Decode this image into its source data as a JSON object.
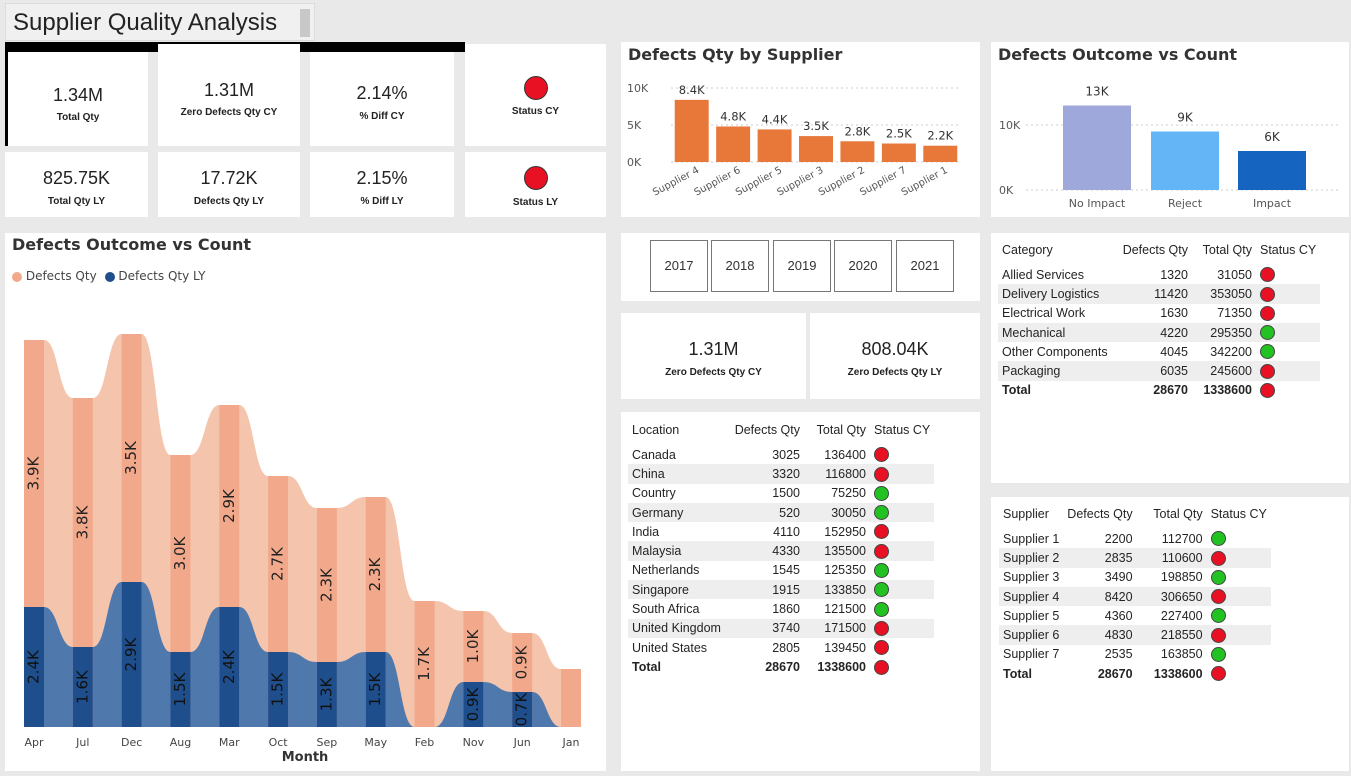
{
  "page_title": "Supplier Quality Analysis",
  "kpis": {
    "total_qty": {
      "value": "1.34M",
      "label": "Total Qty"
    },
    "zero_defects_cy": {
      "value": "1.31M",
      "label": "Zero Defects Qty CY"
    },
    "pct_diff_cy": {
      "value": "2.14%",
      "label": "% Diff CY"
    },
    "status_cy": {
      "label": "Status CY",
      "color": "#e81123"
    },
    "total_qty_ly": {
      "value": "825.75K",
      "label": "Total Qty LY"
    },
    "defects_qty_ly": {
      "value": "17.72K",
      "label": "Defects Qty LY"
    },
    "pct_diff_ly": {
      "value": "2.15%",
      "label": "% Diff LY"
    },
    "status_ly": {
      "label": "Status LY",
      "color": "#e81123"
    }
  },
  "supplier_chart_title": "Defects Qty by Supplier",
  "outcome_chart_title": "Defects Outcome vs Count",
  "ribbon_chart_title": "Defects Outcome vs Count",
  "year_slicer": [
    "2017",
    "2018",
    "2019",
    "2020",
    "2021"
  ],
  "zero_cards": {
    "cy": {
      "value": "1.31M",
      "label": "Zero Defects Qty CY"
    },
    "ly": {
      "value": "808.04K",
      "label": "Zero Defects Qty LY"
    }
  },
  "chart_data": [
    {
      "type": "bar",
      "title": "Defects Qty by Supplier",
      "categories": [
        "Supplier 4",
        "Supplier 6",
        "Supplier 5",
        "Supplier 3",
        "Supplier 2",
        "Supplier 7",
        "Supplier 1"
      ],
      "values": [
        8.4,
        4.8,
        4.4,
        3.5,
        2.8,
        2.5,
        2.2
      ],
      "labels": [
        "8.4K",
        "4.8K",
        "4.4K",
        "3.5K",
        "2.8K",
        "2.5K",
        "2.2K"
      ],
      "y_ticks": [
        "10K",
        "5K",
        "0K"
      ],
      "ylim": [
        0,
        10
      ],
      "color": "#e8773a",
      "grid": true
    },
    {
      "type": "bar",
      "title": "Defects Outcome vs Count",
      "categories": [
        "No Impact",
        "Reject",
        "Impact"
      ],
      "values": [
        13,
        9,
        6
      ],
      "labels": [
        "13K",
        "9K",
        "6K"
      ],
      "colors": [
        "#9fa8da",
        "#64b5f6",
        "#1565c0"
      ],
      "y_ticks": [
        "10K",
        "0K"
      ],
      "ylim": [
        0,
        14
      ],
      "grid": true
    },
    {
      "type": "area",
      "title": "Defects Outcome vs Count",
      "xlabel": "Month",
      "categories": [
        "Apr",
        "Jul",
        "Dec",
        "Aug",
        "Mar",
        "Oct",
        "Sep",
        "May",
        "Feb",
        "Nov",
        "Jun",
        "Jan"
      ],
      "series": [
        {
          "name": "Defects Qty",
          "color": "#f2a98b",
          "values": [
            3.9,
            3.8,
            3.5,
            3.0,
            2.9,
            2.7,
            2.3,
            2.3,
            1.7,
            1.0,
            0.9,
            0.0
          ],
          "labels": [
            "3.9K",
            "3.8K",
            "3.5K",
            "3.0K",
            "2.9K",
            "2.7K",
            "2.3K",
            "2.3K",
            "1.7K",
            "1.0K",
            "0.9K",
            ""
          ]
        },
        {
          "name": "Defects Qty LY",
          "color": "#1f4e8c",
          "values": [
            2.4,
            1.6,
            2.9,
            1.5,
            2.4,
            1.5,
            1.3,
            1.5,
            0.0,
            0.9,
            0.7,
            0.0
          ],
          "labels": [
            "2.4K",
            "1.6K",
            "2.9K",
            "1.5K",
            "2.4K",
            "1.5K",
            "1.3K",
            "1.5K",
            "",
            "0.9K",
            "0.7K",
            ""
          ]
        }
      ]
    }
  ],
  "location_table": {
    "headers": [
      "Location",
      "Defects Qty",
      "Total Qty",
      "Status CY"
    ],
    "rows": [
      [
        "Canada",
        "3025",
        "136400",
        "red"
      ],
      [
        "China",
        "3320",
        "116800",
        "red"
      ],
      [
        "Country",
        "1500",
        "75250",
        "green"
      ],
      [
        "Germany",
        "520",
        "30050",
        "green"
      ],
      [
        "India",
        "4110",
        "152950",
        "red"
      ],
      [
        "Malaysia",
        "4330",
        "135500",
        "red"
      ],
      [
        "Netherlands",
        "1545",
        "125350",
        "green"
      ],
      [
        "Singapore",
        "1915",
        "133850",
        "green"
      ],
      [
        "South Africa",
        "1860",
        "121500",
        "green"
      ],
      [
        "United Kingdom",
        "3740",
        "171500",
        "red"
      ],
      [
        "United States",
        "2805",
        "139450",
        "red"
      ]
    ],
    "total": [
      "Total",
      "28670",
      "1338600",
      "red"
    ]
  },
  "category_table": {
    "headers": [
      "Category",
      "Defects Qty",
      "Total Qty",
      "Status CY"
    ],
    "rows": [
      [
        "Allied Services",
        "1320",
        "31050",
        "red"
      ],
      [
        "Delivery Logistics",
        "11420",
        "353050",
        "red"
      ],
      [
        "Electrical Work",
        "1630",
        "71350",
        "red"
      ],
      [
        "Mechanical",
        "4220",
        "295350",
        "green"
      ],
      [
        "Other Components",
        "4045",
        "342200",
        "green"
      ],
      [
        "Packaging",
        "6035",
        "245600",
        "red"
      ]
    ],
    "total": [
      "Total",
      "28670",
      "1338600",
      "red"
    ]
  },
  "supplier_table": {
    "headers": [
      "Supplier",
      "Defects Qty",
      "Total Qty",
      "Status CY"
    ],
    "rows": [
      [
        "Supplier 1",
        "2200",
        "112700",
        "green"
      ],
      [
        "Supplier 2",
        "2835",
        "110600",
        "red"
      ],
      [
        "Supplier 3",
        "3490",
        "198850",
        "green"
      ],
      [
        "Supplier 4",
        "8420",
        "306650",
        "red"
      ],
      [
        "Supplier 5",
        "4360",
        "227400",
        "green"
      ],
      [
        "Supplier 6",
        "4830",
        "218550",
        "red"
      ],
      [
        "Supplier 7",
        "2535",
        "163850",
        "green"
      ]
    ],
    "total": [
      "Total",
      "28670",
      "1338600",
      "red"
    ]
  }
}
